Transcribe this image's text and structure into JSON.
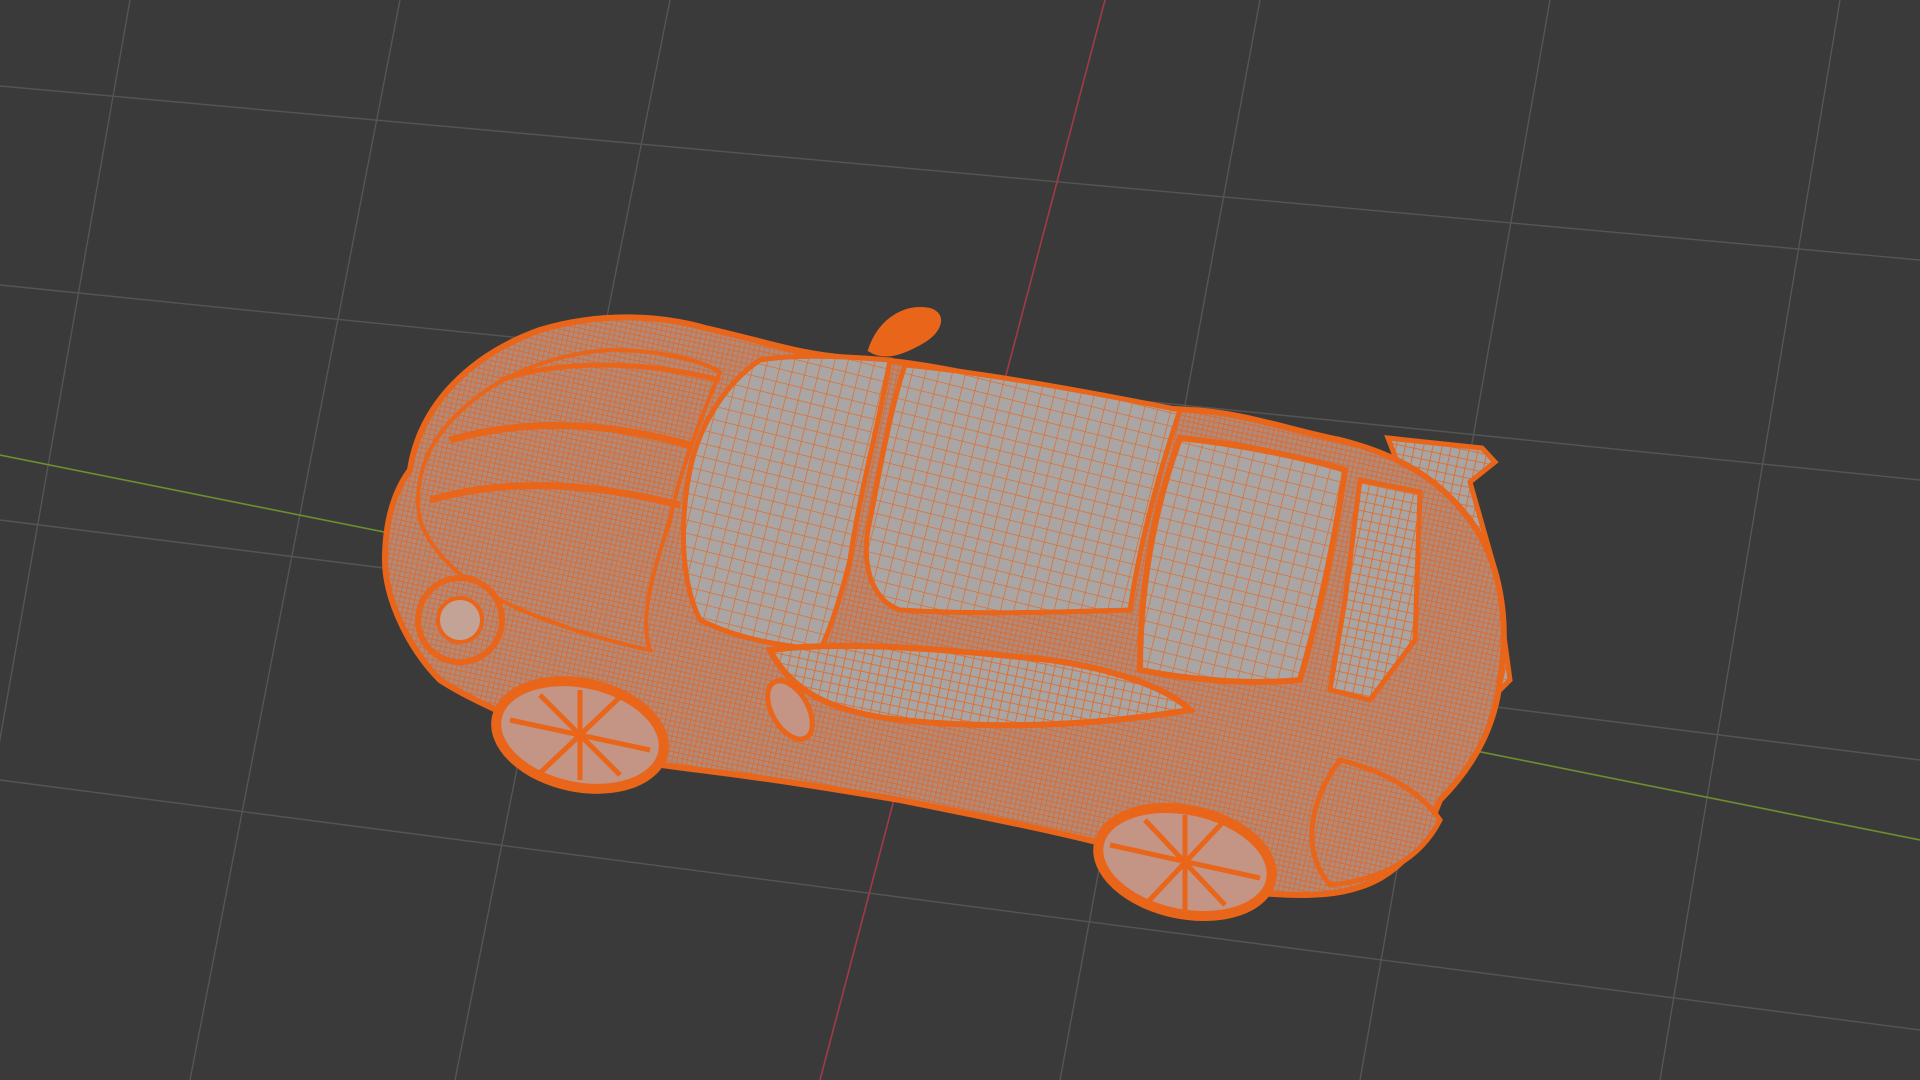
{
  "viewport": {
    "background_color": "#3a3a3a",
    "grid_color": "#555555",
    "x_axis_color": "#a03a44",
    "y_axis_color": "#6e8f2e",
    "selection_color": "#e8651a",
    "mesh_fill_color": "#a9a5a4"
  },
  "scene": {
    "object_icon": "car-mesh-icon"
  }
}
